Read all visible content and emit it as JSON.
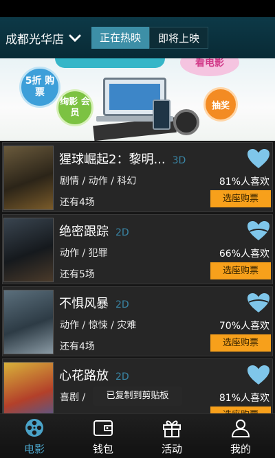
{
  "header": {
    "store_name": "成都光华店",
    "tabs": [
      {
        "label": "正在热映",
        "active": true
      },
      {
        "label": "即将上映",
        "active": false
      }
    ]
  },
  "banner": {
    "discount": "5折 购票",
    "member": "绚影 会员",
    "lottery": "抽奖",
    "top_label": "看电影"
  },
  "movies": [
    {
      "title": "猩球崛起2：黎明...",
      "format": "3D",
      "genre": "剧情 / 动作 / 科幻",
      "sessions_left": "还有4场",
      "like_rate": "81%人喜欢",
      "buy_label": "选座购票"
    },
    {
      "title": "绝密跟踪",
      "format": "2D",
      "genre": "动作 / 犯罪",
      "sessions_left": "还有5场",
      "like_rate": "66%人喜欢",
      "buy_label": "选座购票"
    },
    {
      "title": "不惧风暴",
      "format": "2D",
      "genre": "动作 / 惊悚 / 灾难",
      "sessions_left": "还有4场",
      "like_rate": "70%人喜欢",
      "buy_label": "选座购票"
    },
    {
      "title": "心花路放",
      "format": "2D",
      "genre": "喜剧 / ",
      "sessions_left": "",
      "like_rate": "81%人喜欢",
      "buy_label": "选座购票"
    }
  ],
  "toast": "已复制到剪贴板",
  "tabbar": [
    {
      "label": "电影",
      "icon": "film-reel-icon",
      "active": true
    },
    {
      "label": "钱包",
      "icon": "wallet-icon",
      "active": false
    },
    {
      "label": "活动",
      "icon": "gift-icon",
      "active": false
    },
    {
      "label": "我的",
      "icon": "person-icon",
      "active": false
    }
  ],
  "colors": {
    "accent": "#3d8fa7",
    "buy_button": "#f7a01b",
    "heart": "#7fc6ea",
    "tab_active": "#4aa3c8",
    "format_label": "#3a86a6"
  }
}
